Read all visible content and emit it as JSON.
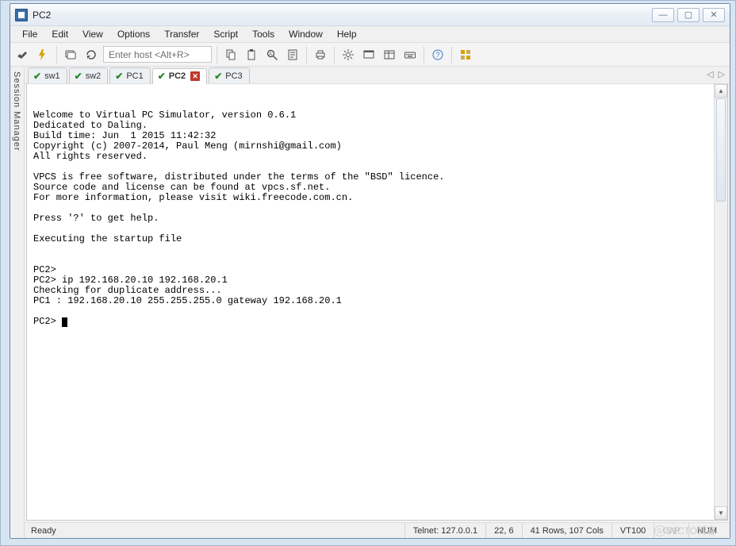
{
  "window": {
    "title": "PC2"
  },
  "window_buttons": {
    "min": "—",
    "max": "▢",
    "close": "✕"
  },
  "menu": {
    "items": [
      "File",
      "Edit",
      "View",
      "Options",
      "Transfer",
      "Script",
      "Tools",
      "Window",
      "Help"
    ]
  },
  "toolbar": {
    "host_placeholder": "Enter host <Alt+R>",
    "icons": [
      "connect",
      "quick",
      "sessions",
      "reconnect",
      "sep",
      "copy",
      "paste",
      "find",
      "history",
      "sep",
      "print",
      "sep",
      "settings",
      "view",
      "hex",
      "keyboard",
      "sep",
      "help",
      "sep",
      "tile"
    ]
  },
  "sidebar": {
    "label": "Session Manager"
  },
  "tabs": {
    "items": [
      {
        "label": "sw1",
        "connected": true,
        "active": false,
        "closable": false
      },
      {
        "label": "sw2",
        "connected": true,
        "active": false,
        "closable": false
      },
      {
        "label": "PC1",
        "connected": true,
        "active": false,
        "closable": false
      },
      {
        "label": "PC2",
        "connected": true,
        "active": true,
        "closable": true
      },
      {
        "label": "PC3",
        "connected": true,
        "active": false,
        "closable": false
      }
    ],
    "nav_left": "◁",
    "nav_right": "▷"
  },
  "terminal": {
    "lines": [
      "",
      "Welcome to Virtual PC Simulator, version 0.6.1",
      "Dedicated to Daling.",
      "Build time: Jun  1 2015 11:42:32",
      "Copyright (c) 2007-2014, Paul Meng (mirnshi@gmail.com)",
      "All rights reserved.",
      "",
      "VPCS is free software, distributed under the terms of the \"BSD\" licence.",
      "Source code and license can be found at vpcs.sf.net.",
      "For more information, please visit wiki.freecode.com.cn.",
      "",
      "Press '?' to get help.",
      "",
      "Executing the startup file",
      "",
      "",
      "PC2>",
      "PC2> ip 192.168.20.10 192.168.20.1",
      "Checking for duplicate address...",
      "PC1 : 192.168.20.10 255.255.255.0 gateway 192.168.20.1",
      ""
    ],
    "prompt": "PC2> "
  },
  "status": {
    "ready": "Ready",
    "protocol": "Telnet: 127.0.0.1",
    "cursor": "22,  6",
    "size": "41 Rows, 107 Cols",
    "term": "VT100",
    "caps": "CAP",
    "num": "NUM"
  },
  "watermark": "51CTO博客"
}
